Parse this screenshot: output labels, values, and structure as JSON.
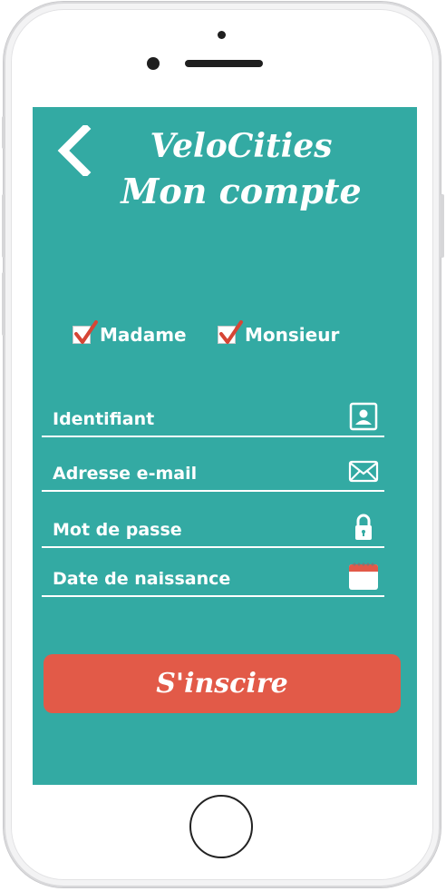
{
  "app": {
    "name": "VeloCities",
    "page_title": "Mon compte"
  },
  "gender": {
    "options": [
      {
        "label": "Madame",
        "checked": true
      },
      {
        "label": "Monsieur",
        "checked": true
      }
    ]
  },
  "form": {
    "fields": [
      {
        "label": "Identifiant",
        "icon": "contact-card-icon"
      },
      {
        "label": "Adresse e-mail",
        "icon": "envelope-icon"
      },
      {
        "label": "Mot de passe",
        "icon": "padlock-icon"
      },
      {
        "label": "Date de naissance",
        "icon": "calendar-icon"
      }
    ],
    "submit_label": "S'inscire"
  },
  "colors": {
    "background": "#33aaa3",
    "button": "#e25a48",
    "text": "#ffffff",
    "check": "#d64535"
  }
}
